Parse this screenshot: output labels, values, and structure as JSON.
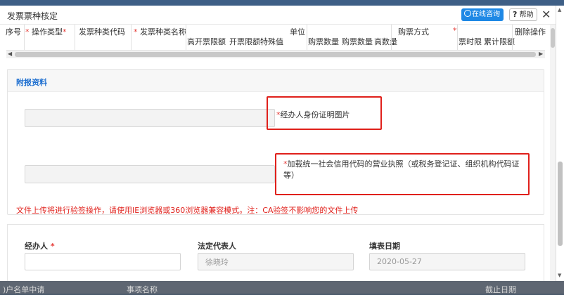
{
  "dialog": {
    "title": "发票票种核定",
    "consult_label": "在线咨询",
    "help_label": "帮助",
    "close_glyph": "✕"
  },
  "table": {
    "headers": [
      {
        "text": "序号",
        "required": false
      },
      {
        "text": "操作类型",
        "required": true
      },
      {
        "text": "发票种类代码",
        "required": true
      },
      {
        "text": "发票种类名称",
        "required": true
      },
      {
        "text": "单位",
        "required": false
      },
      {
        "text": "购票方式",
        "required": false
      },
      {
        "text": "删除操作",
        "required": false
      }
    ],
    "subheaders": [
      "高开票限额",
      "开票限额特殊值",
      "购票数量",
      "购票数量",
      "高数量",
      "票时限",
      "累计限额"
    ]
  },
  "attachments": {
    "section_title": "附报资料",
    "items": [
      {
        "label": "经办人身份证明图片",
        "required": true
      },
      {
        "label": "加载统一社会信用代码的营业执照（或税务登记证、组织机构代码证等）",
        "required": true
      }
    ],
    "notice": "文件上传将进行验签操作，请使用IE浏览器或360浏览器兼容模式。注：CA验签不影响您的文件上传"
  },
  "form": {
    "agent_label": "经办人",
    "agent_value": "",
    "legal_rep_label": "法定代表人",
    "legal_rep_value": "徐晓玲",
    "date_label": "填表日期",
    "date_value": "2020-05-27"
  },
  "background": {
    "left_text": ")户名单中请",
    "mid_text": "事项名称",
    "right_text": "截止日期"
  },
  "colors": {
    "accent": "#1e88e5",
    "required": "#e53935",
    "highlight_box": "#e0201b",
    "section_title": "#1e6fd0"
  }
}
